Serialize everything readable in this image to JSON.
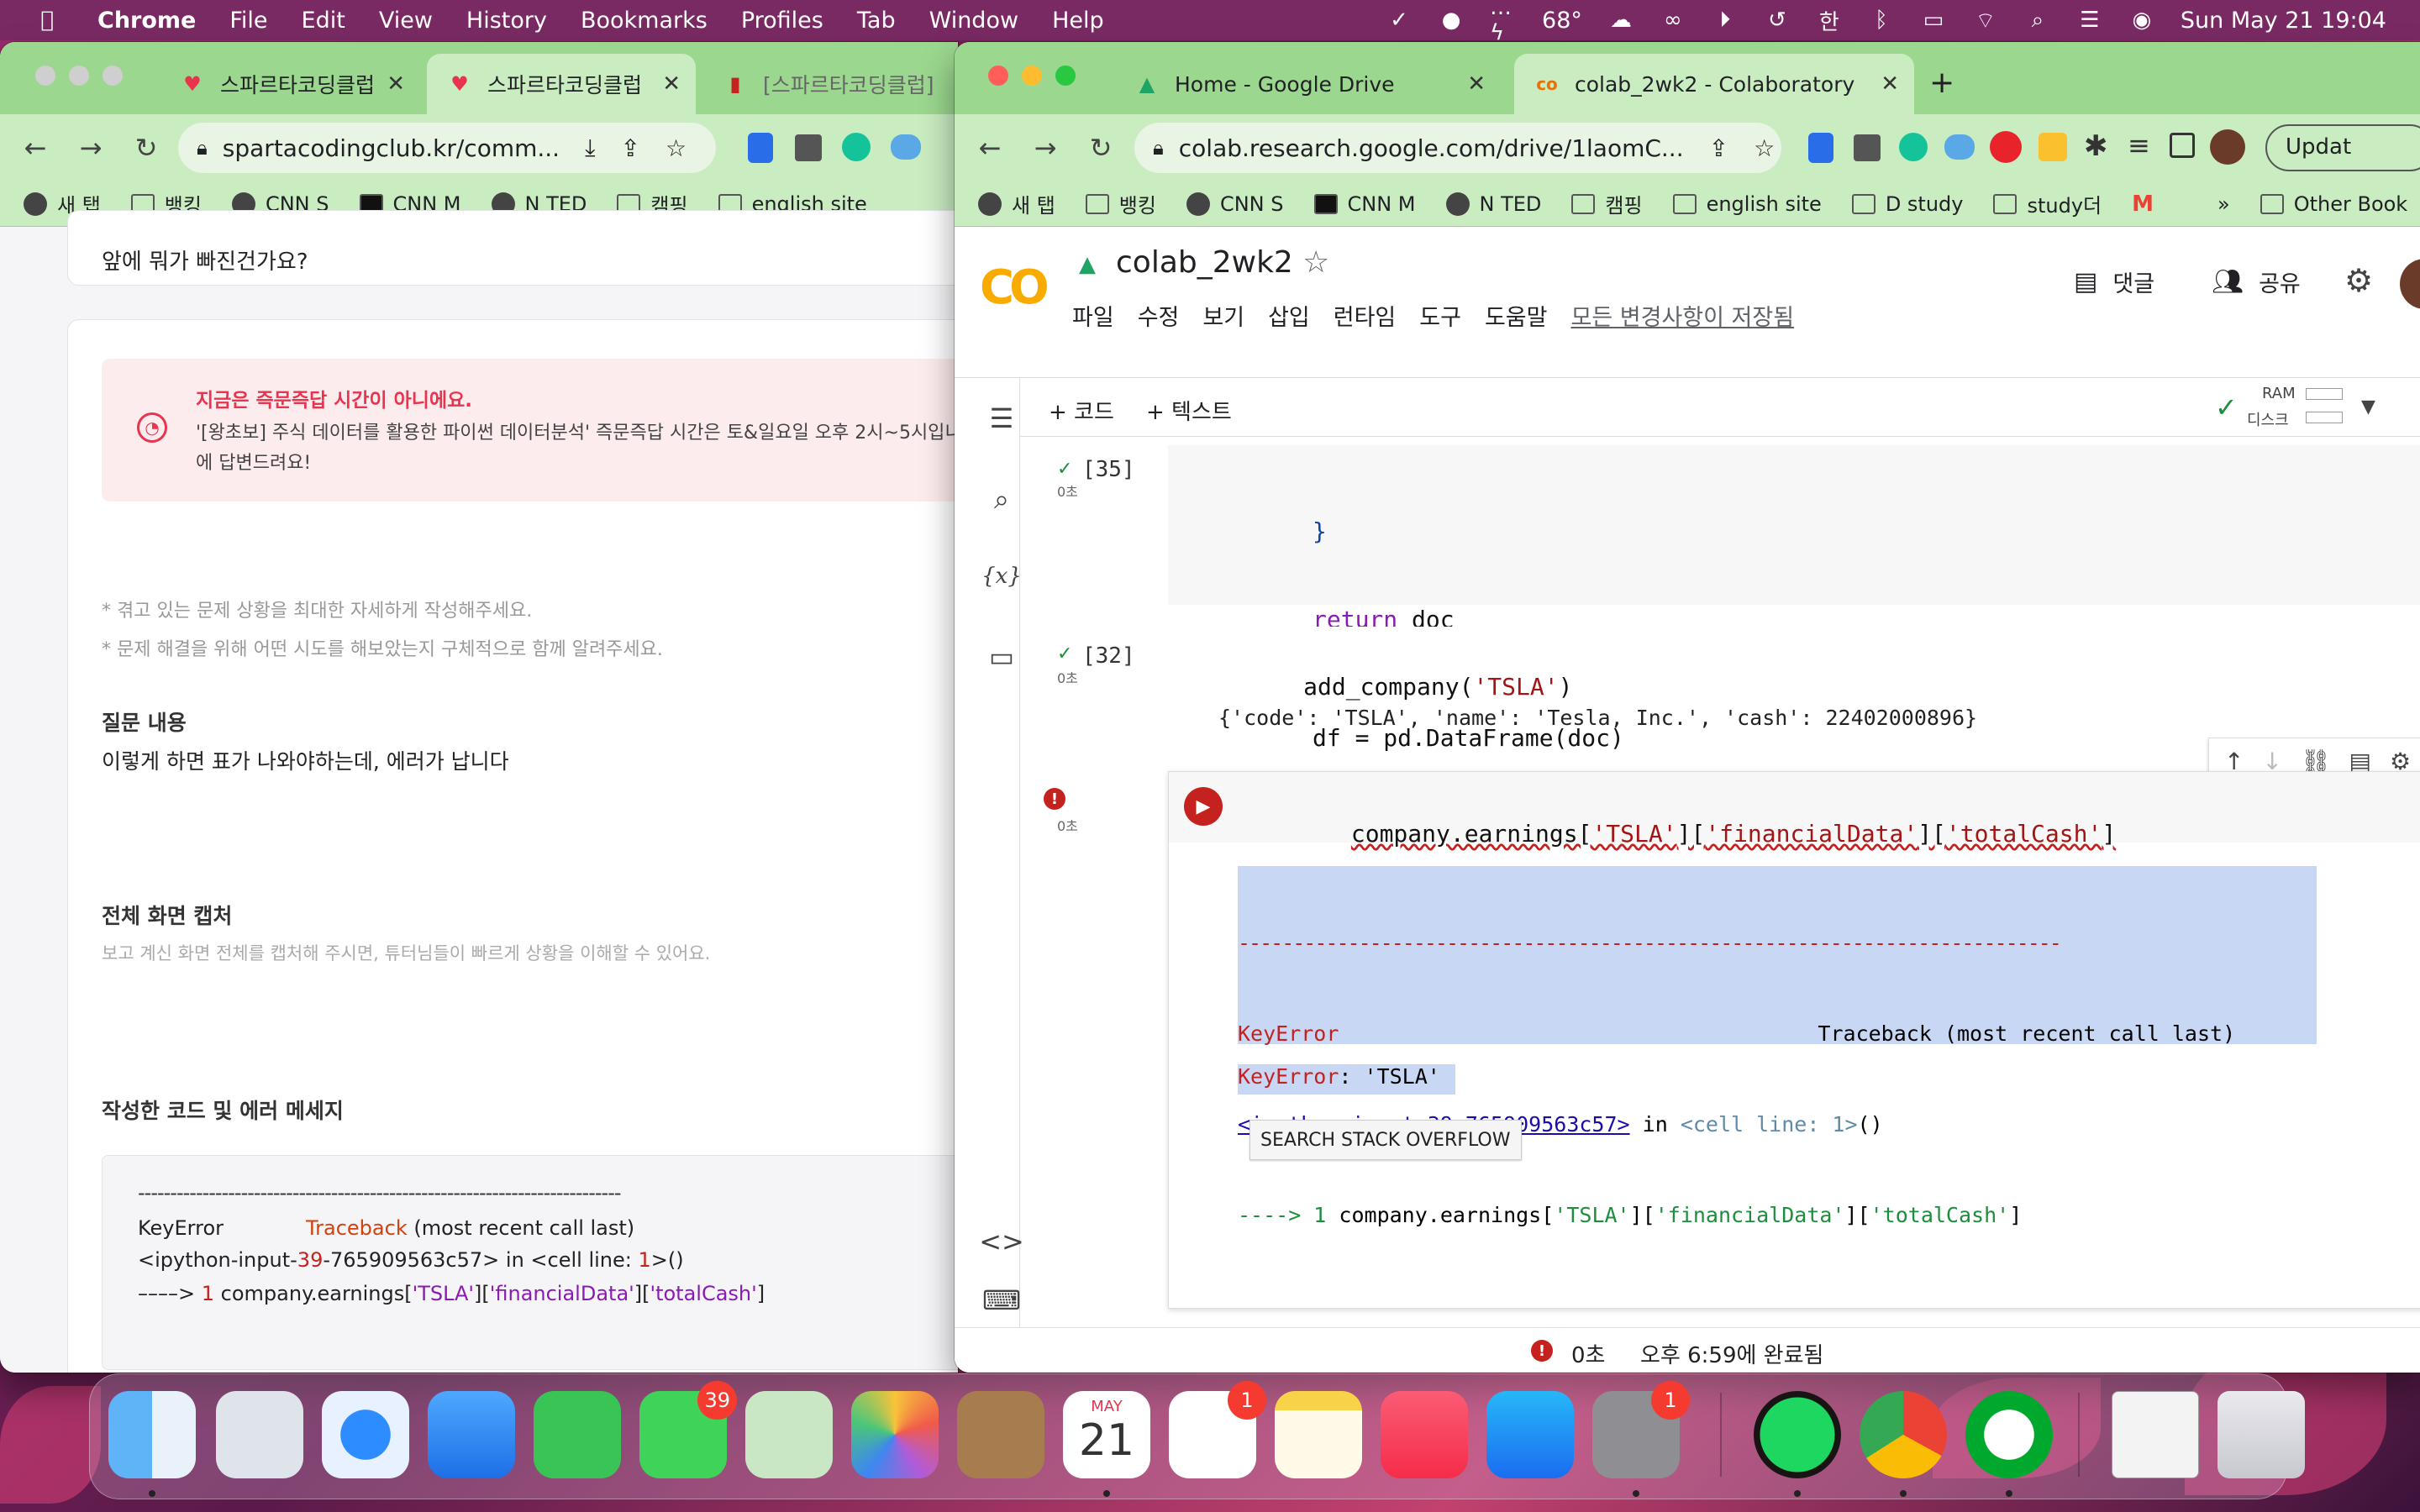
{
  "menubar": {
    "app": "Chrome",
    "items": [
      "File",
      "Edit",
      "View",
      "History",
      "Bookmarks",
      "Profiles",
      "Tab",
      "Window",
      "Help"
    ],
    "weather": "68°",
    "datetime": "Sun May 21  19:04",
    "lang": "한"
  },
  "left_browser": {
    "tabs": [
      {
        "title": "스파르타코딩클럽"
      },
      {
        "title": "스파르타코딩클럽"
      },
      {
        "title": "[스파르타코딩클럽]"
      }
    ],
    "url": "spartacodingclub.kr/comm...",
    "bookmarks": [
      "새 탭",
      "뱅킹",
      "CNN S",
      "CNN M",
      "N TED",
      "캠핑",
      "english site"
    ],
    "page": {
      "top_text": "앞에 뭐가 빠진건가요?",
      "notice_title": "지금은 즉문즉답 시간이 아니에요.",
      "notice_body_1": "'[왕초보] 주식 데이터를 활용한 파이썬 데이터분석' 즉문즉답 시간은 토&일요일 오후 2시~5시입니",
      "notice_body_2": "에 답변드려요!",
      "hint_1": "* 겪고 있는 문제 상황을 최대한 자세하게 작성해주세요.",
      "hint_2": "* 문제 해결을 위해 어떤 시도를 해보았는지 구체적으로 함께 알려주세요.",
      "q_label": "질문 내용",
      "q_text": "이렇게 하면 표가 나와야하는데, 에러가 납니다",
      "cap_label": "전체 화면 캡처",
      "cap_hint": "보고 계신 화면 전체를 캡처해 주시면, 튜터님들이 빠르게 상황을 이해할 수 있어요.",
      "code_label": "작성한 코드 및 에러 메세지",
      "code_dashes": "---------------------------------------------------------------------------",
      "code_line_1a": "KeyError",
      "code_line_1b": "Traceback",
      "code_line_1c": " (most recent call last)",
      "code_line_2a": "<ipython-input-",
      "code_line_2b": "39",
      "code_line_2c": "-765909563c57> in <cell line: ",
      "code_line_2d": "1",
      "code_line_2e": ">()",
      "code_line_3a": "––––> ",
      "code_line_3b": "1",
      "code_line_3c": " company.earnings[",
      "code_line_3d": "'TSLA'",
      "code_line_3e": "][",
      "code_line_3f": "'financialData'",
      "code_line_3g": "][",
      "code_line_3h": "'totalCash'",
      "code_line_3i": "]"
    }
  },
  "right_browser": {
    "tabs": [
      {
        "title": "Home - Google Drive"
      },
      {
        "title": "colab_2wk2 - Colaboratory"
      }
    ],
    "url": "colab.research.google.com/drive/1laomC...",
    "update_label": "Updat",
    "bookmarks": [
      "새 탭",
      "뱅킹",
      "CNN S",
      "CNN M",
      "N TED",
      "캠핑",
      "english site",
      "D study",
      "study더"
    ],
    "bookmarks_more": "»",
    "other_bookmarks": "Other Book"
  },
  "colab": {
    "logo": "CO",
    "title": "colab_2wk2",
    "menu": [
      "파일",
      "수정",
      "보기",
      "삽입",
      "런타임",
      "도구",
      "도움말"
    ],
    "saved": "모든 변경사항이 저장됨",
    "comment": "댓글",
    "share": "공유",
    "add_code": "+ 코드",
    "add_text": "+ 텍스트",
    "ram": "RAM",
    "disk": "디스크",
    "cell1": {
      "num": "[35]",
      "time": "0초",
      "line1": "}",
      "line2_kw": "return",
      "line2_rest": " doc",
      "line3": "df = pd.DataFrame(doc)"
    },
    "cell2": {
      "num": "[32]",
      "time": "0초",
      "code_a": "add_company(",
      "code_b": "'TSLA'",
      "code_c": ")",
      "output": "{'code': 'TSLA', 'name': 'Tesla, Inc.', 'cash': 22402000896}"
    },
    "cell3": {
      "time": "0초",
      "code_a": "company.earnings[",
      "code_b": "'TSLA'",
      "code_c": "][",
      "code_d": "'financialData'",
      "code_e": "][",
      "code_f": "'totalCash'",
      "code_g": "]",
      "tb_dashes": "---------------------------------------------------------------------------",
      "tb_err": "KeyError",
      "tb_traceback": "Traceback (most recent call last)",
      "tb_link": "<ipython-input-39-765909563c57>",
      "tb_in": " in ",
      "tb_cell": "<cell line: 1>",
      "tb_paren": "()",
      "tb_arrow": "----> 1",
      "tb_line": " company.earnings[",
      "tb_s1": "'TSLA'",
      "tb_s2": "'financialData'",
      "tb_s3": "'totalCash'",
      "tb_bracket_mid": "][",
      "tb_bracket_end": "]",
      "final_err": "KeyError",
      "final_msg": ": 'TSLA'",
      "so_button": "SEARCH STACK OVERFLOW"
    },
    "status_time": "0초",
    "status_done": "오후 6:59에 완료됨"
  },
  "dock": {
    "messages_badge": "39",
    "calendar_month": "MAY",
    "calendar_day": "21",
    "reminders_badge": "1",
    "settings_badge": "1"
  },
  "colors": {
    "tab_green": "#9bd78f",
    "toolbar_green": "#c9ecc1",
    "error_red": "#c5221f",
    "colab_orange": "#f9ab00"
  }
}
